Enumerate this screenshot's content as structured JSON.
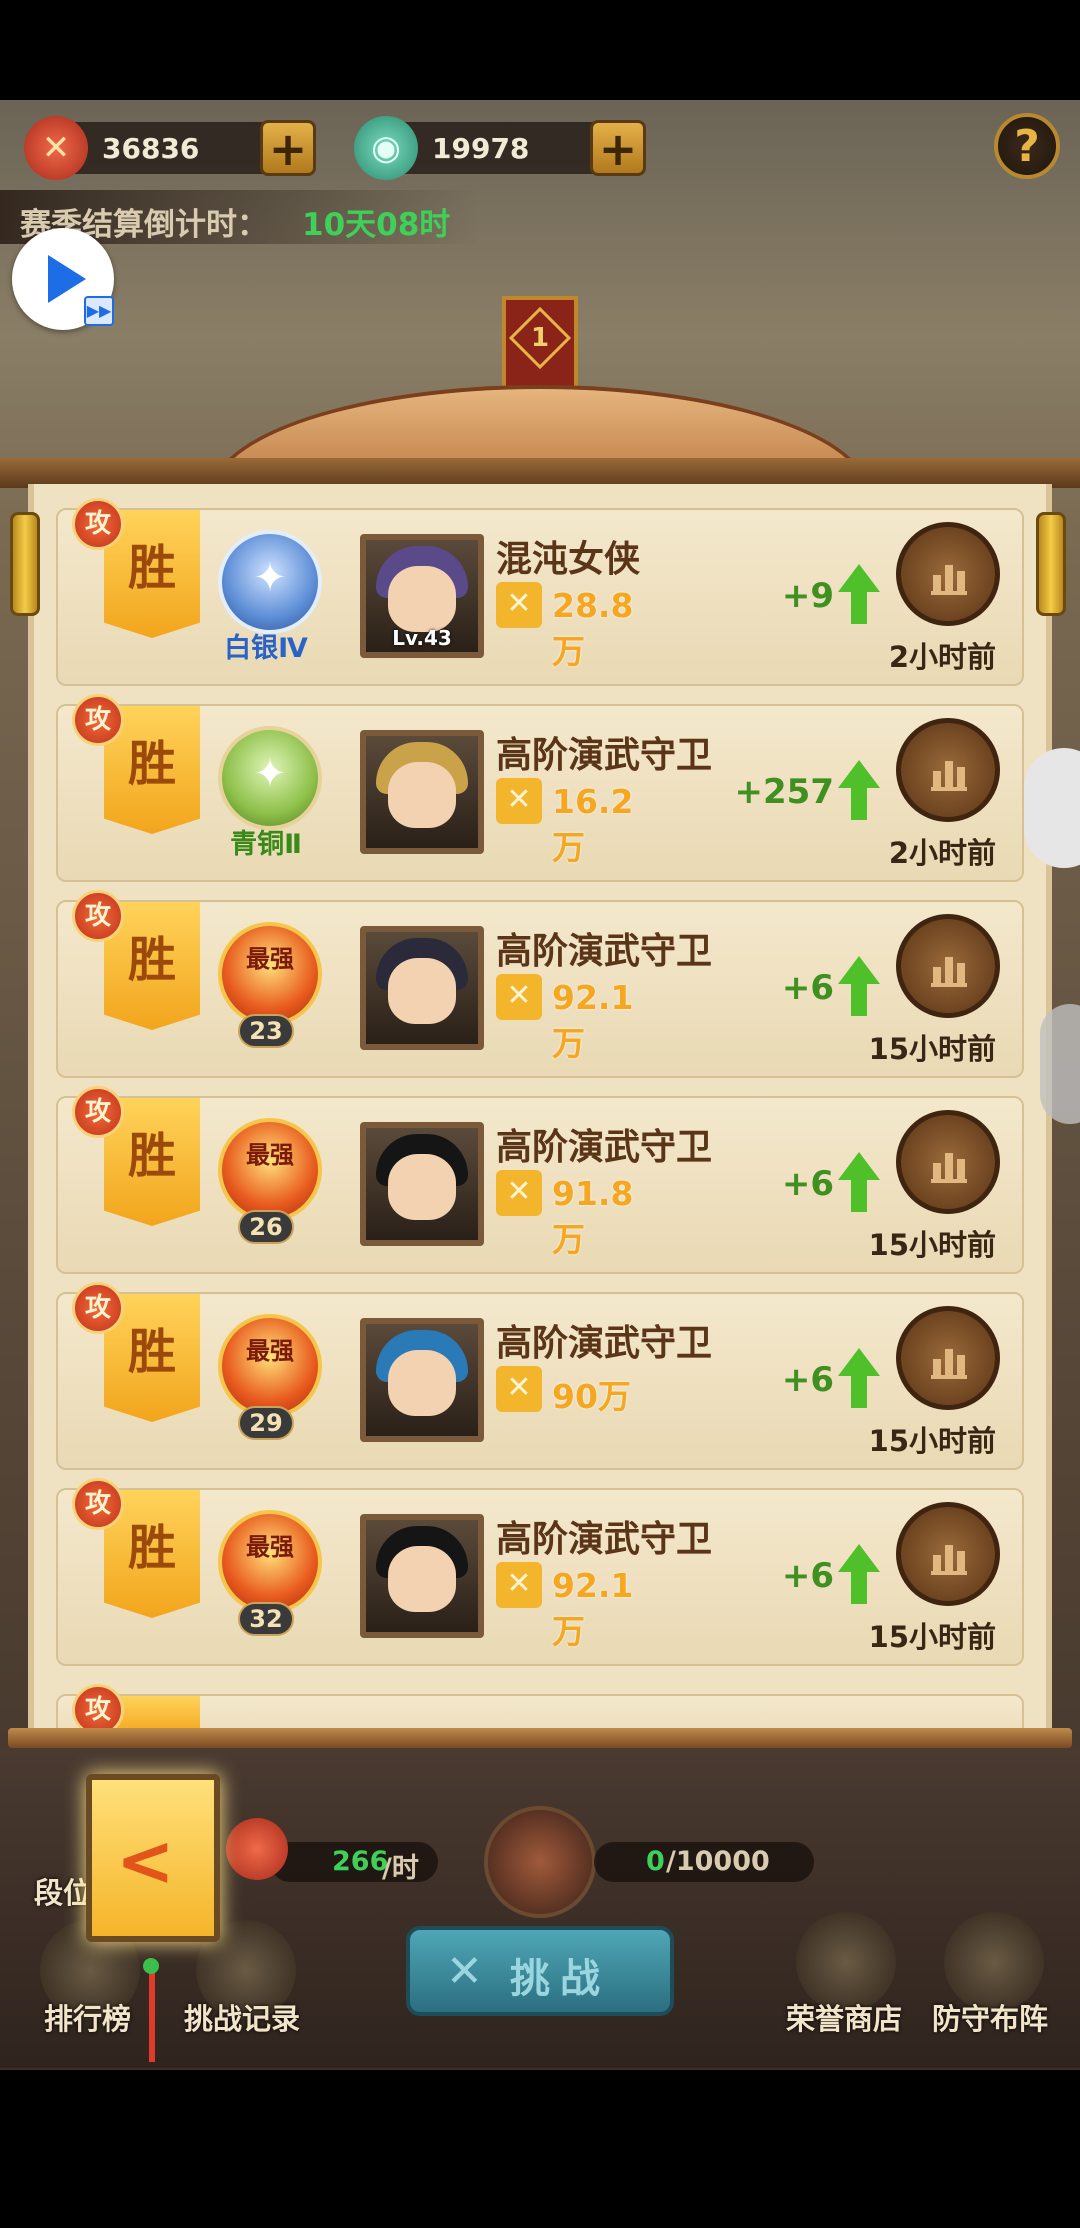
{
  "resources": [
    {
      "name": "medal",
      "value": "36836",
      "color": "#d94a2a"
    },
    {
      "name": "jade-coin",
      "value": "19978",
      "color": "#3aa889"
    }
  ],
  "help_icon": "?",
  "countdown": {
    "label": "赛季结算倒计时：",
    "value": "10天08时"
  },
  "rank_flag": "1",
  "records": [
    {
      "tag": "攻",
      "result": "胜",
      "badge_type": "silver",
      "badge_label": "白银Ⅳ",
      "badge_num": "",
      "level": "Lv.43",
      "name": "混沌女侠",
      "power": "28.8万",
      "delta": "+9",
      "time": "2小时前",
      "hair": "#5a4a8a"
    },
    {
      "tag": "攻",
      "result": "胜",
      "badge_type": "bronze",
      "badge_label": "青铜Ⅱ",
      "badge_num": "",
      "level": "",
      "name": "高阶演武守卫",
      "power": "16.2万",
      "delta": "+257",
      "time": "2小时前",
      "hair": "#c9a24a"
    },
    {
      "tag": "攻",
      "result": "胜",
      "badge_type": "gold",
      "badge_label": "",
      "badge_num": "23",
      "level": "",
      "name": "高阶演武守卫",
      "power": "92.1万",
      "delta": "+6",
      "time": "15小时前",
      "hair": "#2a2a3a"
    },
    {
      "tag": "攻",
      "result": "胜",
      "badge_type": "gold",
      "badge_label": "",
      "badge_num": "26",
      "level": "",
      "name": "高阶演武守卫",
      "power": "91.8万",
      "delta": "+6",
      "time": "15小时前",
      "hair": "#151515"
    },
    {
      "tag": "攻",
      "result": "胜",
      "badge_type": "gold",
      "badge_label": "",
      "badge_num": "29",
      "level": "",
      "name": "高阶演武守卫",
      "power": "90万",
      "delta": "+6",
      "time": "15小时前",
      "hair": "#2a7ab8"
    },
    {
      "tag": "攻",
      "result": "胜",
      "badge_type": "gold",
      "badge_label": "",
      "badge_num": "32",
      "level": "",
      "name": "高阶演武守卫",
      "power": "92.1万",
      "delta": "+6",
      "time": "15小时前",
      "hair": "#151515"
    }
  ],
  "gold_badge_text": "最强",
  "partial_tag": "攻",
  "income": {
    "rate": "266",
    "rate_unit": "/时",
    "progress": "0",
    "progress_total": "/10000"
  },
  "challenge_label": "挑战",
  "nav": {
    "rank": "排行榜",
    "record": "挑战记录",
    "shop": "荣誉商店",
    "defense": "防守布阵",
    "tier": "段位"
  },
  "colors": {
    "green_text": "#2fc44a",
    "accent": "#f5a722"
  }
}
